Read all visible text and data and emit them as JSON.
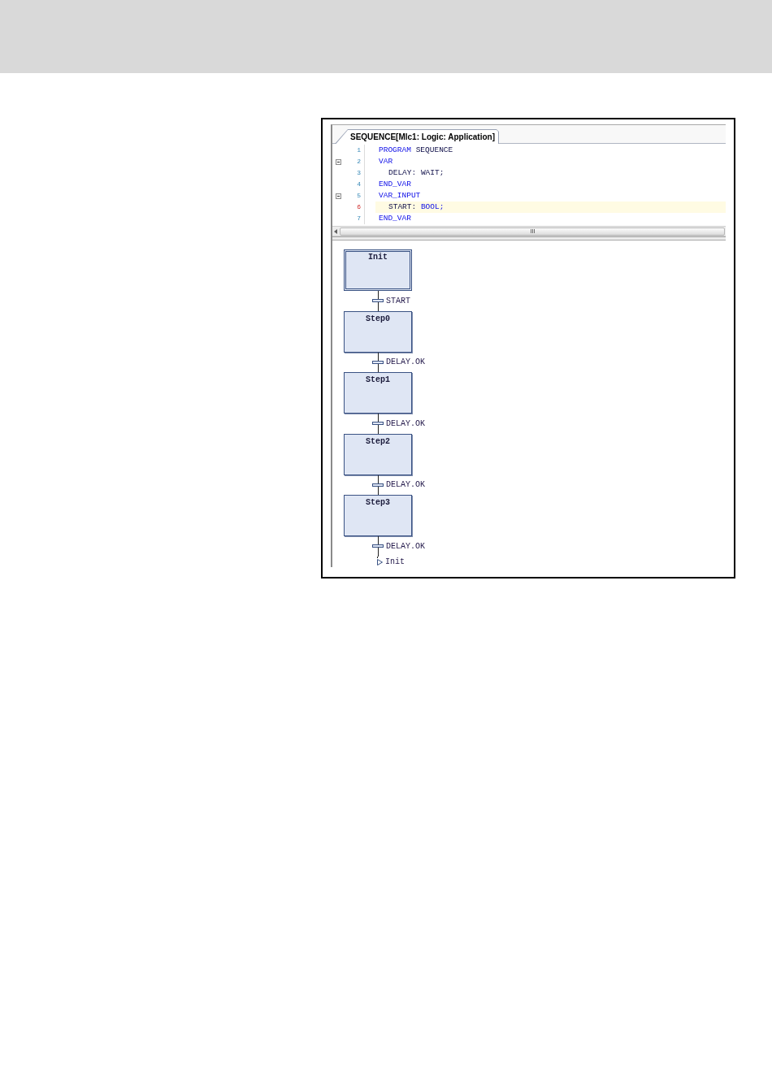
{
  "editor_tab": {
    "title": "SEQUENCE[Mlc1: Logic: Application]",
    "selected": true
  },
  "code_lines": [
    {
      "number": "1",
      "foldable": false,
      "current": false,
      "indented": false,
      "tokens": [
        {
          "kind": "keyword",
          "text": "PROGRAM"
        },
        {
          "kind": "identifier",
          "text": "SEQUENCE"
        }
      ]
    },
    {
      "number": "2",
      "foldable": true,
      "current": false,
      "indented": false,
      "tokens": [
        {
          "kind": "keyword",
          "text": "VAR"
        }
      ]
    },
    {
      "number": "3",
      "foldable": false,
      "current": false,
      "indented": true,
      "tokens": [
        {
          "kind": "identifier",
          "text": "DELAY: WAIT;"
        }
      ]
    },
    {
      "number": "4",
      "foldable": false,
      "current": false,
      "indented": false,
      "tokens": [
        {
          "kind": "keyword",
          "text": "END_VAR"
        }
      ]
    },
    {
      "number": "5",
      "foldable": true,
      "current": false,
      "indented": false,
      "tokens": [
        {
          "kind": "keyword",
          "text": "VAR_INPUT"
        }
      ]
    },
    {
      "number": "6",
      "foldable": false,
      "current": true,
      "indented": true,
      "tokens": [
        {
          "kind": "identifier",
          "text": "START:"
        },
        {
          "kind": "keyword",
          "text": "BOOL;"
        }
      ]
    },
    {
      "number": "7",
      "foldable": false,
      "current": false,
      "indented": false,
      "tokens": [
        {
          "kind": "keyword",
          "text": "END_VAR"
        }
      ]
    }
  ],
  "sfc": {
    "steps": [
      {
        "name": "Init",
        "initial": true
      },
      {
        "name": "Step0",
        "initial": false
      },
      {
        "name": "Step1",
        "initial": false
      },
      {
        "name": "Step2",
        "initial": false
      },
      {
        "name": "Step3",
        "initial": false
      }
    ],
    "transitions": [
      {
        "condition": "START"
      },
      {
        "condition": "DELAY.OK"
      },
      {
        "condition": "DELAY.OK"
      },
      {
        "condition": "DELAY.OK"
      },
      {
        "condition": "DELAY.OK"
      }
    ],
    "jump": {
      "target": "Init"
    }
  }
}
